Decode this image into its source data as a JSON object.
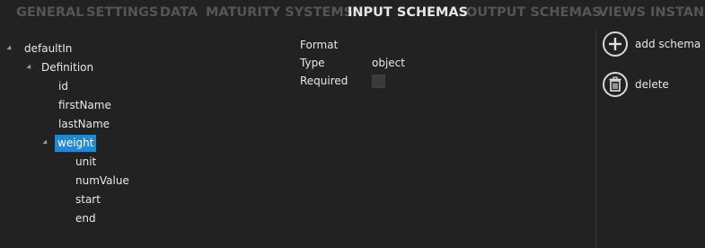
{
  "tabs": [
    {
      "label": "GENERAL",
      "active": false
    },
    {
      "label": "SETTINGS",
      "active": false
    },
    {
      "label": "DATA",
      "active": false
    },
    {
      "label": "MATURITY SYSTEMS",
      "active": false
    },
    {
      "label": "INPUT SCHEMAS",
      "active": true
    },
    {
      "label": "OUTPUT SCHEMAS",
      "active": false
    },
    {
      "label": "VIEWS",
      "active": false
    },
    {
      "label": "INSTANC",
      "active": false
    }
  ],
  "tree": {
    "nodes": [
      {
        "label": "defaultIn",
        "expanded": true
      },
      {
        "label": "Definition",
        "expanded": true
      },
      {
        "label": "id"
      },
      {
        "label": "firstName"
      },
      {
        "label": "lastName"
      },
      {
        "label": "weight",
        "expanded": true,
        "selected": true
      },
      {
        "label": "unit"
      },
      {
        "label": "numValue"
      },
      {
        "label": "start"
      },
      {
        "label": "end"
      }
    ]
  },
  "properties": {
    "format_label": "Format",
    "format_value": "",
    "type_label": "Type",
    "type_value": "object",
    "required_label": "Required",
    "required_checked": false
  },
  "actions": {
    "add_label": "add schema",
    "add_icon": "plus-circle-icon",
    "delete_label": "delete",
    "delete_icon": "trash-icon"
  },
  "colors": {
    "background": "#222222",
    "selection": "#1e8ad6",
    "tab_inactive": "#555555",
    "tab_active": "#e6e6e6"
  }
}
